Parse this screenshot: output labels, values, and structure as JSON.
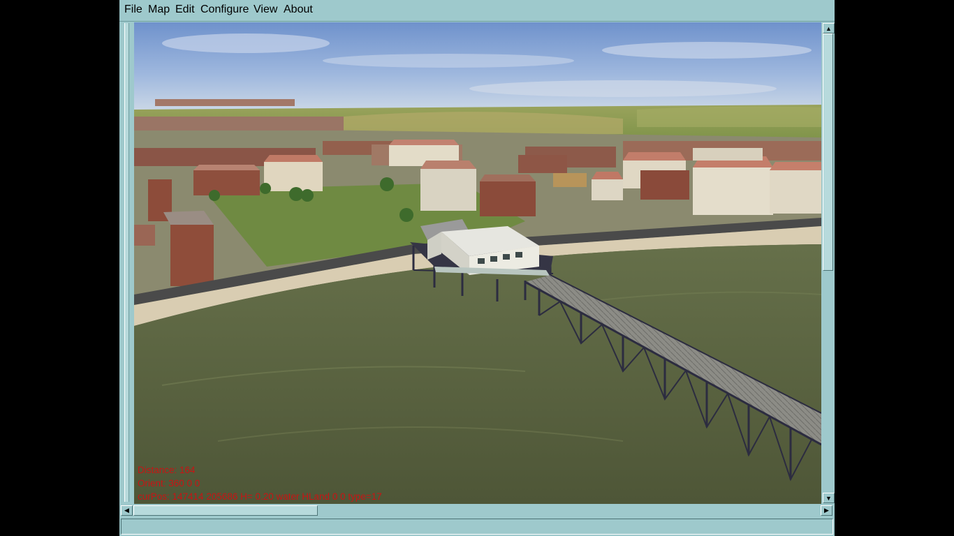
{
  "menu": {
    "items": [
      {
        "label": "File"
      },
      {
        "label": "Map"
      },
      {
        "label": "Edit"
      },
      {
        "label": "Configure"
      },
      {
        "label": "View"
      },
      {
        "label": "About"
      }
    ]
  },
  "overlay": {
    "distance": "Distance: 164",
    "orient": "Orient: 360 0 0",
    "cur_pos": "curPos: 147414 205686 H= 0.20 water HLand 0 0 type=17"
  },
  "scroll": {
    "up_glyph": "▲",
    "down_glyph": "▼",
    "left_glyph": "◀",
    "right_glyph": "▶"
  },
  "colors": {
    "window_bg": "#9ec9cc",
    "overlay_text": "#c81414",
    "sea": "#57603f",
    "sky": "#7e9fd4"
  }
}
